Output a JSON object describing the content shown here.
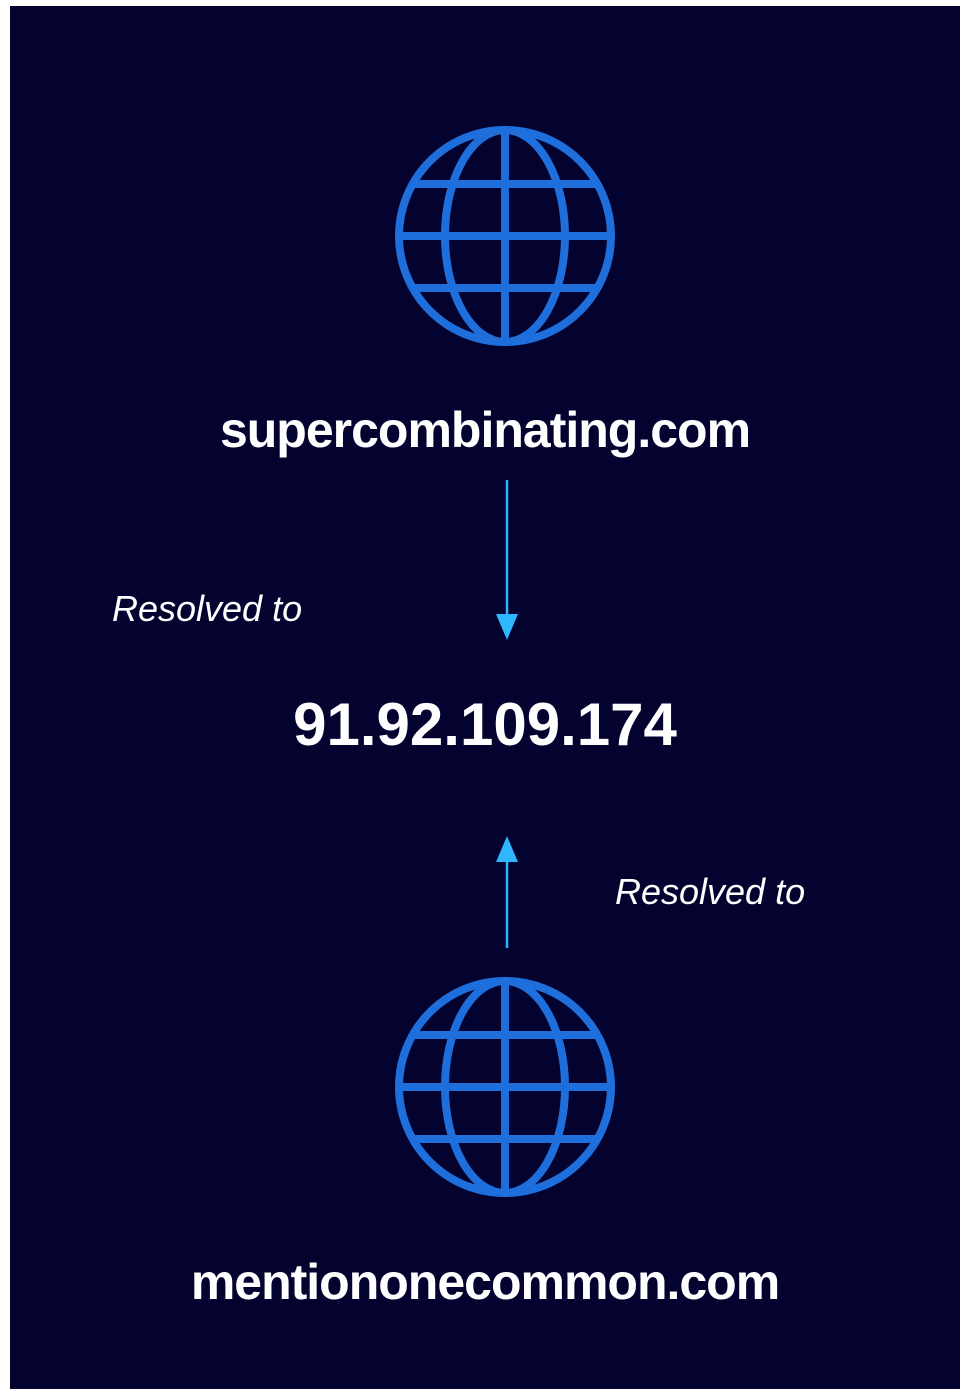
{
  "diagram": {
    "top_domain": "supercombinating.com",
    "ip_address": "91.92.109.174",
    "bottom_domain": "mentiononecommon.com",
    "top_label": "Resolved to",
    "bottom_label": "Resolved to"
  },
  "icons": {
    "top_globe": "globe-icon",
    "bottom_globe": "globe-icon",
    "down_arrow": "arrow-down-icon",
    "up_arrow": "arrow-up-icon"
  },
  "colors": {
    "background": "#04022f",
    "globe": "#1e6fdb",
    "arrow": "#2eb6ff",
    "text": "#ffffff"
  }
}
